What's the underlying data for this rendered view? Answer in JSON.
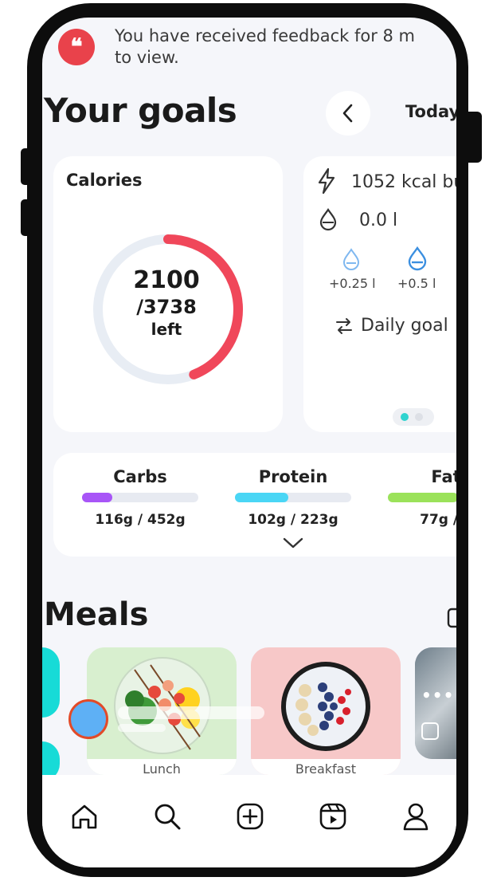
{
  "notification": {
    "icon": "quote-icon",
    "text_line1": "You have received feedback for 8 m",
    "text_line2": "to view."
  },
  "goals": {
    "title": "Your goals",
    "day_label": "Today"
  },
  "calories": {
    "label": "Calories",
    "remaining": "2100",
    "total": "/3738",
    "suffix": "left",
    "progress_fraction": 0.44,
    "ring_color": "#f0475a",
    "track_color": "#e8edf4"
  },
  "activity": {
    "burned": "1052 kcal bu",
    "water": "0.0 l",
    "water_small": "+0.25 l",
    "water_large": "+0.5 l",
    "daily_goal": "Daily goal"
  },
  "macros": [
    {
      "name": "Carbs",
      "value": "116g / 452g",
      "fraction": 0.257,
      "color": "#a855f7"
    },
    {
      "name": "Protein",
      "value": "102g / 223g",
      "fraction": 0.457,
      "color": "#4ad6f5"
    },
    {
      "name": "Fat",
      "value": "77g / 1",
      "fraction": 0.6,
      "color": "#9be25a"
    }
  ],
  "meals": {
    "title": "Meals",
    "items": [
      {
        "label": "Lunch",
        "bg": "#d8efcf"
      },
      {
        "label": "Breakfast",
        "bg": "#f7c8c8"
      }
    ]
  },
  "nav": {
    "items": [
      "home-icon",
      "search-icon",
      "add-icon",
      "reels-icon",
      "profile-icon"
    ]
  },
  "colors": {
    "accent_teal": "#2fd3cf",
    "notification_red": "#e9424b"
  }
}
